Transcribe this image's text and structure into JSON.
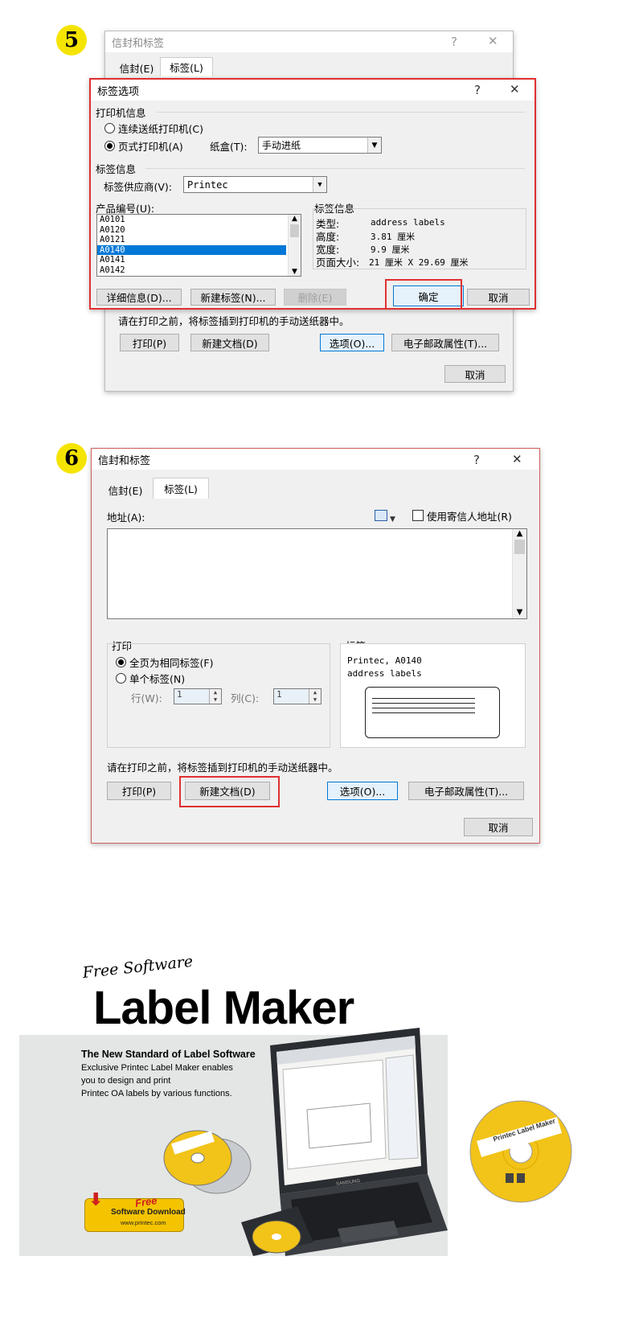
{
  "step5": {
    "badge": "5",
    "bg_window": {
      "title": "信封和标签",
      "help": "?",
      "close": "✕",
      "tabs": [
        "信封(E)",
        "标签(L)"
      ],
      "hint": "请在打印之前，将标签插到打印机的手动送纸器中。",
      "buttons": {
        "print": "打印(P)",
        "new_doc": "新建文档(D)",
        "options": "选项(O)...",
        "postage": "电子邮政属性(T)...",
        "cancel": "取消"
      }
    },
    "dialog": {
      "title": "标签选项",
      "help": "?",
      "close": "✕",
      "printer_info_label": "打印机信息",
      "radio_continuous": "连续送纸打印机(C)",
      "radio_page": "页式打印机(A)",
      "tray_label": "纸盒(T):",
      "tray_value": "手动进纸",
      "label_info_label": "标签信息",
      "vendor_label": "标签供应商(V):",
      "vendor_value": "Printec",
      "product_label": "产品编号(U):",
      "products": [
        "A0101",
        "A0120",
        "A0121",
        "A0140",
        "A0141",
        "A0142"
      ],
      "selected_product": "A0140",
      "info_title": "标签信息",
      "info": {
        "type_label": "类型:",
        "type_value": "address labels",
        "height_label": "高度:",
        "height_value": "3.81 厘米",
        "width_label": "宽度:",
        "width_value": "9.9 厘米",
        "page_label": "页面大小:",
        "page_value": "21 厘米 X 29.69 厘米"
      },
      "buttons": {
        "details": "详细信息(D)...",
        "new_label": "新建标签(N)...",
        "delete": "删除(E)",
        "ok": "确定",
        "cancel": "取消"
      }
    }
  },
  "step6": {
    "badge": "6",
    "window": {
      "title": "信封和标签",
      "help": "?",
      "close": "✕",
      "tabs": [
        "信封(E)",
        "标签(L)"
      ],
      "address_label": "地址(A):",
      "use_return_address": "使用寄信人地址(R)",
      "print_group": "打印",
      "radio_full_page": "全页为相同标签(F)",
      "radio_single": "单个标签(N)",
      "row_label": "行(W):",
      "col_label": "列(C):",
      "row_value": "1",
      "col_value": "1",
      "label_group": "标签",
      "label_line1": "Printec, A0140",
      "label_line2": "address labels",
      "hint": "请在打印之前，将标签插到打印机的手动送纸器中。",
      "buttons": {
        "print": "打印(P)",
        "new_doc": "新建文档(D)",
        "options": "选项(O)...",
        "postage": "电子邮政属性(T)...",
        "cancel": "取消"
      }
    }
  },
  "ad": {
    "free_software": "Free Software",
    "title": "Label Maker",
    "headline": "The New Standard of Label Software",
    "desc1": "Exclusive Printec Label Maker enables",
    "desc2": "you to design and print",
    "desc3": "Printec OA labels by various functions.",
    "badge_free": "Free",
    "badge_software": "Software",
    "badge_download": "Download",
    "badge_url": "www.printec.com",
    "cd_label": "Printec Label Maker",
    "laptop_brand": "SAMSUNG"
  },
  "colors": {
    "highlight_red": "#e03030",
    "badge_yellow": "#f5e400",
    "selection_blue": "#0078d7"
  }
}
